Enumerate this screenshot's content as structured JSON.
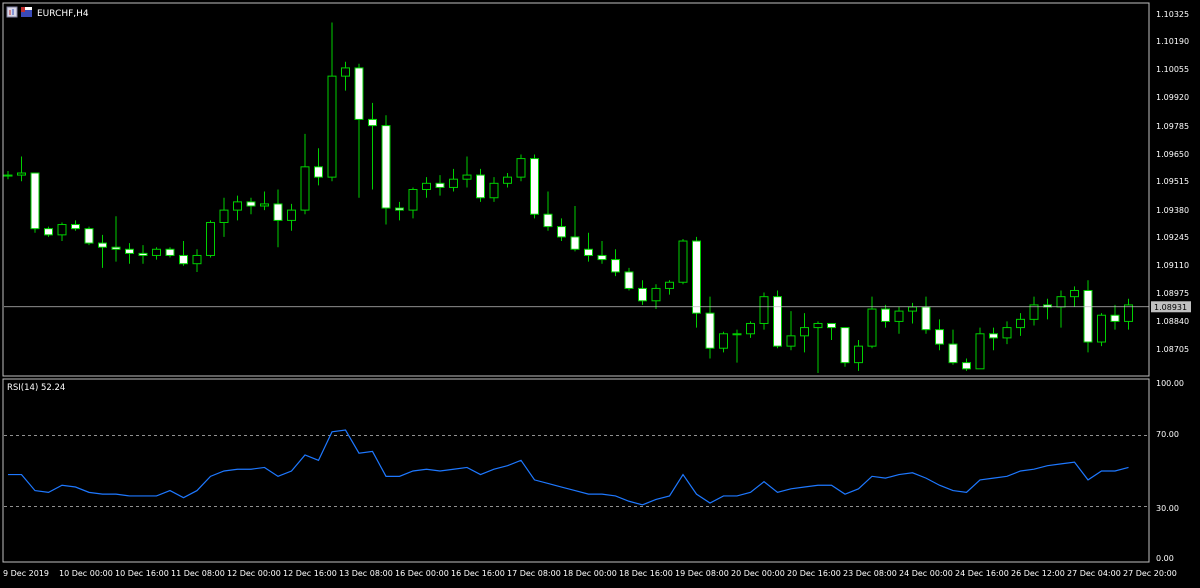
{
  "symbol_label": "EURCHF,H4",
  "colors": {
    "background": "#000000",
    "frame": "#c0c0c0",
    "bull_fill": "#000000",
    "bear_fill": "#ffffff",
    "wick": "#00d000",
    "rsi_line": "#1e78ff",
    "bid_line": "#c0c0c0",
    "price_tag_bg": "#c0c0c0",
    "text": "#ffffff"
  },
  "icons": [
    "chart-window-icon",
    "flag-icon"
  ],
  "chart_data": [
    {
      "type": "candlestick",
      "title": "EURCHF,H4",
      "ylim": [
        1.086,
        1.104
      ],
      "y_ticks": [
        "1.10325",
        "1.10190",
        "1.10055",
        "1.09920",
        "1.09785",
        "1.09650",
        "1.09515",
        "1.09380",
        "1.09245",
        "1.09110",
        "1.08975",
        "1.08840",
        "1.08705"
      ],
      "current_price": "1.08931",
      "x_tick_labels": [
        "9 Dec 2019",
        "10 Dec 00:00",
        "10 Dec 16:00",
        "11 Dec 08:00",
        "12 Dec 00:00",
        "12 Dec 16:00",
        "13 Dec 08:00",
        "16 Dec 00:00",
        "16 Dec 16:00",
        "17 Dec 08:00",
        "18 Dec 00:00",
        "18 Dec 16:00",
        "19 Dec 08:00",
        "20 Dec 00:00",
        "20 Dec 16:00",
        "23 Dec 08:00",
        "24 Dec 00:00",
        "24 Dec 16:00",
        "26 Dec 12:00",
        "27 Dec 04:00",
        "27 Dec 20:00"
      ],
      "candles": [
        [
          1.0957,
          1.0959,
          1.0955,
          1.0957
        ],
        [
          1.0957,
          1.0966,
          1.0954,
          1.0958
        ],
        [
          1.0958,
          1.0958,
          1.0929,
          1.0931
        ],
        [
          1.0931,
          1.0932,
          1.0927,
          1.0928
        ],
        [
          1.0928,
          1.0934,
          1.0925,
          1.0933
        ],
        [
          1.0933,
          1.0935,
          1.093,
          1.0931
        ],
        [
          1.0931,
          1.0932,
          1.0923,
          1.0924
        ],
        [
          1.0924,
          1.0928,
          1.0912,
          1.0922
        ],
        [
          1.0922,
          1.0937,
          1.0915,
          1.0921
        ],
        [
          1.0921,
          1.0924,
          1.0914,
          1.0919
        ],
        [
          1.0919,
          1.0923,
          1.0914,
          1.0918
        ],
        [
          1.0918,
          1.0922,
          1.0916,
          1.0921
        ],
        [
          1.0921,
          1.0922,
          1.0917,
          1.0918
        ],
        [
          1.0918,
          1.0925,
          1.0913,
          1.0914
        ],
        [
          1.0914,
          1.0921,
          1.091,
          1.0918
        ],
        [
          1.0918,
          1.0935,
          1.0917,
          1.0934
        ],
        [
          1.0934,
          1.0946,
          1.0927,
          1.094
        ],
        [
          1.094,
          1.0947,
          1.0935,
          1.0944
        ],
        [
          1.0944,
          1.0946,
          1.0938,
          1.0942
        ],
        [
          1.0942,
          1.0949,
          1.094,
          1.0943
        ],
        [
          1.0943,
          1.095,
          1.0922,
          1.0935
        ],
        [
          1.0935,
          1.0943,
          1.093,
          1.094
        ],
        [
          1.094,
          1.0977,
          1.0938,
          1.0961
        ],
        [
          1.0961,
          1.097,
          1.0952,
          1.0956
        ],
        [
          1.0956,
          1.1031,
          1.0954,
          1.1005
        ],
        [
          1.1005,
          1.1012,
          1.0998,
          1.1009
        ],
        [
          1.1009,
          1.1011,
          1.0946,
          1.0984
        ],
        [
          1.0984,
          1.0992,
          1.095,
          1.0981
        ],
        [
          1.0981,
          1.0986,
          1.0933,
          1.0941
        ],
        [
          1.0941,
          1.0944,
          1.0935,
          1.094
        ],
        [
          1.094,
          1.0951,
          1.0936,
          1.095
        ],
        [
          1.095,
          1.0956,
          1.0946,
          1.0953
        ],
        [
          1.0953,
          1.0957,
          1.0947,
          1.0951
        ],
        [
          1.0951,
          1.096,
          1.0949,
          1.0955
        ],
        [
          1.0955,
          1.0966,
          1.0951,
          1.0957
        ],
        [
          1.0957,
          1.096,
          1.0944,
          1.0946
        ],
        [
          1.0946,
          1.0956,
          1.0944,
          1.0953
        ],
        [
          1.0953,
          1.0958,
          1.0951,
          1.0956
        ],
        [
          1.0956,
          1.0967,
          1.0954,
          1.0965
        ],
        [
          1.0965,
          1.0967,
          1.0936,
          1.0938
        ],
        [
          1.0938,
          1.0949,
          1.093,
          1.0932
        ],
        [
          1.0932,
          1.0936,
          1.0925,
          1.0927
        ],
        [
          1.0927,
          1.0942,
          1.092,
          1.0921
        ],
        [
          1.0921,
          1.0929,
          1.0915,
          1.0918
        ],
        [
          1.0918,
          1.0925,
          1.0914,
          1.0916
        ],
        [
          1.0916,
          1.0921,
          1.0908,
          1.091
        ],
        [
          1.091,
          1.0912,
          1.0901,
          1.0902
        ],
        [
          1.0902,
          1.0906,
          1.0894,
          1.0896
        ],
        [
          1.0896,
          1.0904,
          1.0892,
          1.0902
        ],
        [
          1.0902,
          1.0906,
          1.0899,
          1.0905
        ],
        [
          1.0905,
          1.0926,
          1.0904,
          1.0925
        ],
        [
          1.0925,
          1.0927,
          1.0883,
          1.089
        ],
        [
          1.089,
          1.0898,
          1.0868,
          1.0873
        ],
        [
          1.0873,
          1.0881,
          1.0871,
          1.088
        ],
        [
          1.088,
          1.0882,
          1.0866,
          1.088
        ],
        [
          1.088,
          1.0886,
          1.0878,
          1.0885
        ],
        [
          1.0885,
          1.09,
          1.0882,
          1.0898
        ],
        [
          1.0898,
          1.0901,
          1.0873,
          1.0874
        ],
        [
          1.0874,
          1.0891,
          1.0872,
          1.0879
        ],
        [
          1.0879,
          1.089,
          1.0871,
          1.0883
        ],
        [
          1.0883,
          1.0886,
          1.0861,
          1.0885
        ],
        [
          1.0885,
          1.0885,
          1.0877,
          1.0883
        ],
        [
          1.0883,
          1.0883,
          1.0864,
          1.0866
        ],
        [
          1.0866,
          1.0877,
          1.0862,
          1.0874
        ],
        [
          1.0874,
          1.0898,
          1.0873,
          1.0892
        ],
        [
          1.0892,
          1.0894,
          1.0883,
          1.0886
        ],
        [
          1.0886,
          1.0893,
          1.088,
          1.0891
        ],
        [
          1.0891,
          1.0895,
          1.0885,
          1.0893
        ],
        [
          1.0893,
          1.0898,
          1.088,
          1.0882
        ],
        [
          1.0882,
          1.0887,
          1.0872,
          1.0875
        ],
        [
          1.0875,
          1.0882,
          1.0865,
          1.0866
        ],
        [
          1.0866,
          1.0868,
          1.0862,
          1.0863
        ],
        [
          1.0863,
          1.0883,
          1.0877,
          1.088
        ],
        [
          1.088,
          1.0883,
          1.0872,
          1.0878
        ],
        [
          1.0878,
          1.0886,
          1.0875,
          1.0883
        ],
        [
          1.0883,
          1.089,
          1.0879,
          1.0887
        ],
        [
          1.0887,
          1.0898,
          1.0884,
          1.0894
        ],
        [
          1.0894,
          1.0897,
          1.0887,
          1.0893
        ],
        [
          1.0893,
          1.0901,
          1.0883,
          1.0898
        ],
        [
          1.0898,
          1.0903,
          1.0893,
          1.0901
        ],
        [
          1.0901,
          1.0906,
          1.0871,
          1.0876
        ],
        [
          1.0876,
          1.089,
          1.0874,
          1.0889
        ],
        [
          1.0889,
          1.0894,
          1.0882,
          1.0886
        ],
        [
          1.0886,
          1.0897,
          1.0882,
          1.0894
        ]
      ]
    },
    {
      "type": "line",
      "title": "RSI(14) 52.24",
      "ylim": [
        0,
        100
      ],
      "y_ticks": [
        "100.00",
        "70.00",
        "30.00",
        "0.00"
      ],
      "levels": [
        70,
        30
      ],
      "values": [
        48,
        48,
        39,
        38,
        42,
        41,
        38,
        37,
        37,
        36,
        36,
        36,
        39,
        35,
        39,
        47,
        50,
        51,
        51,
        52,
        47,
        50,
        59,
        56,
        72,
        73,
        60,
        61,
        47,
        47,
        50,
        51,
        50,
        51,
        52,
        48,
        51,
        53,
        56,
        45,
        43,
        41,
        39,
        37,
        37,
        36,
        33,
        31,
        34,
        36,
        48,
        37,
        32,
        36,
        36,
        38,
        44,
        38,
        40,
        41,
        42,
        42,
        37,
        40,
        47,
        46,
        48,
        49,
        46,
        42,
        39,
        38,
        45,
        46,
        47,
        50,
        51,
        53,
        54,
        55,
        45,
        50,
        50,
        52
      ]
    }
  ]
}
